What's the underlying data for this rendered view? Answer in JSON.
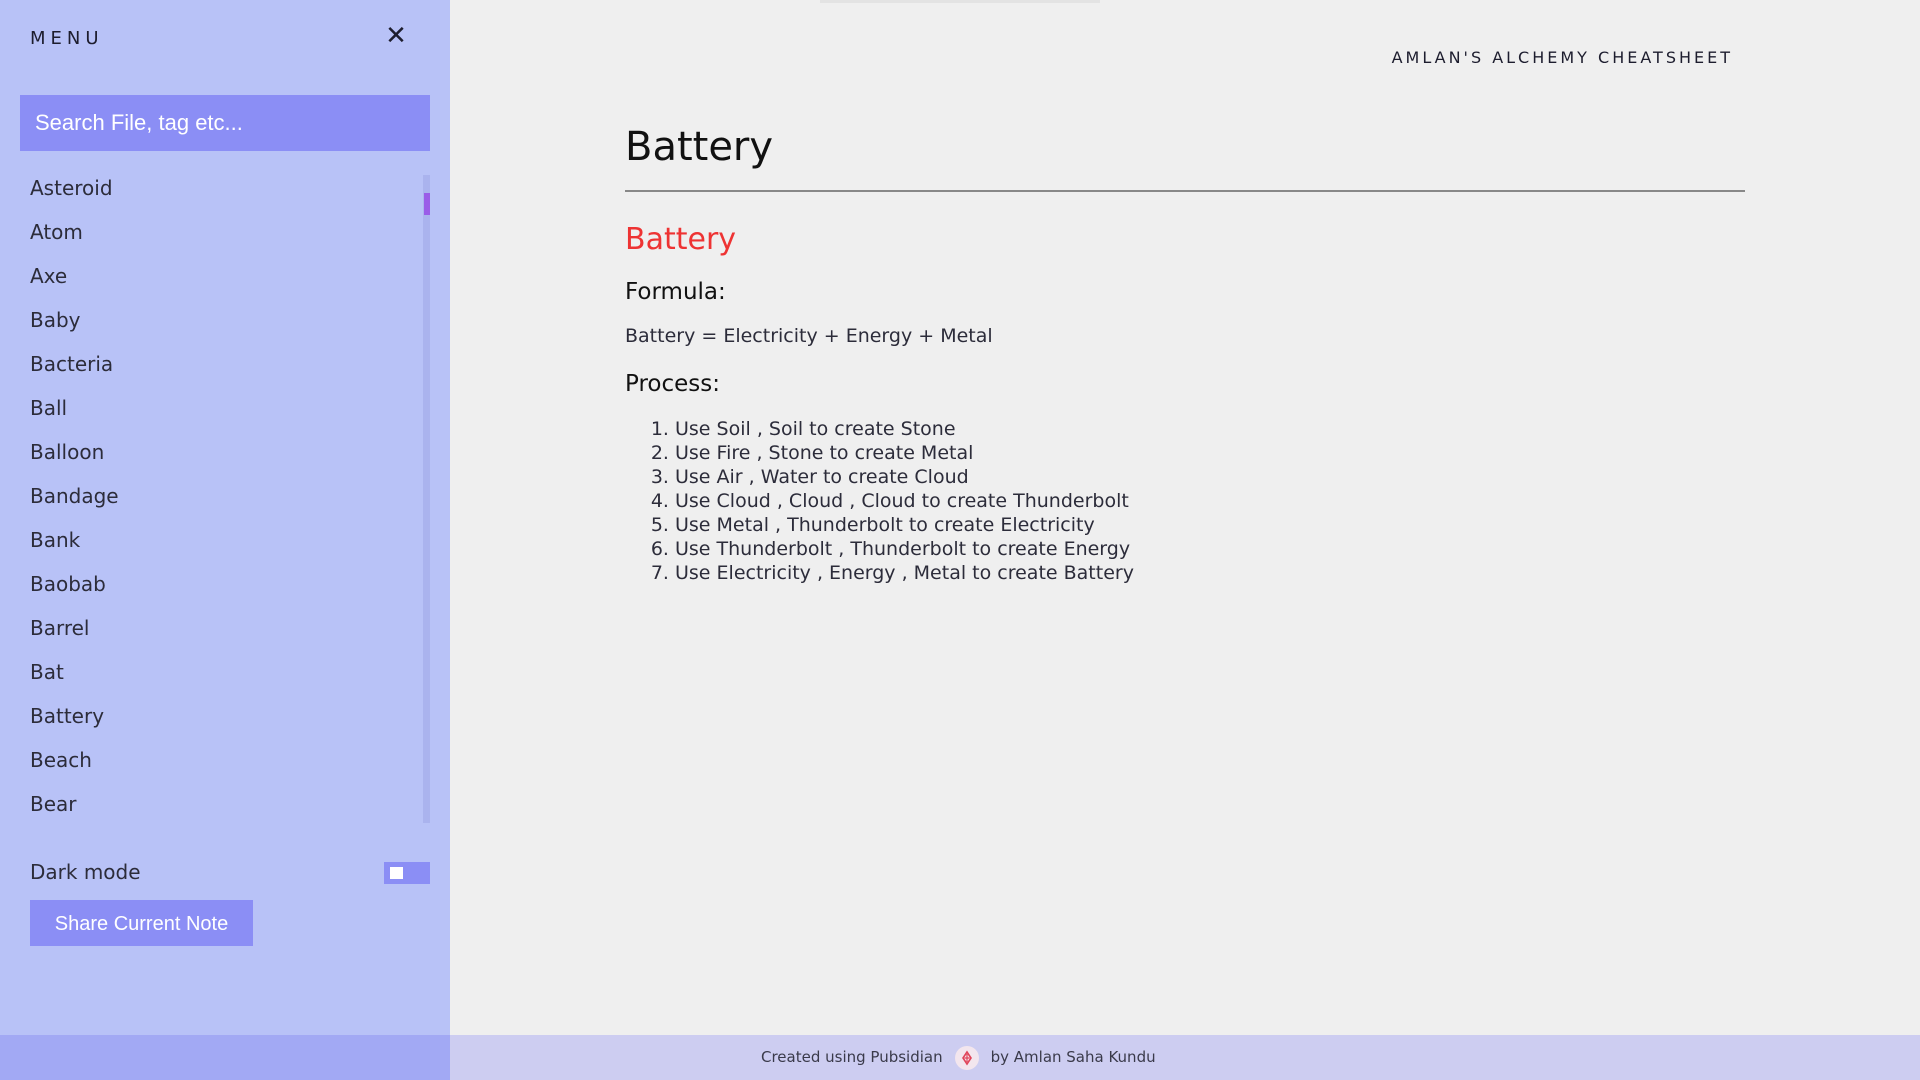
{
  "sidebar": {
    "menu_title": "MENU",
    "close_glyph": "✕",
    "search_placeholder": "Search File, tag etc...",
    "items": [
      {
        "label": "Asteroid"
      },
      {
        "label": "Atom"
      },
      {
        "label": "Axe"
      },
      {
        "label": "Baby"
      },
      {
        "label": "Bacteria"
      },
      {
        "label": "Ball"
      },
      {
        "label": "Balloon"
      },
      {
        "label": "Bandage"
      },
      {
        "label": "Bank"
      },
      {
        "label": "Baobab"
      },
      {
        "label": "Barrel"
      },
      {
        "label": "Bat"
      },
      {
        "label": "Battery"
      },
      {
        "label": "Beach"
      },
      {
        "label": "Bear"
      }
    ],
    "dark_mode_label": "Dark mode",
    "dark_mode_enabled": false,
    "share_label": "Share Current Note"
  },
  "header": {
    "site_title": "AMLAN'S ALCHEMY CHEATSHEET"
  },
  "note": {
    "page_title": "Battery",
    "heading": "Battery",
    "formula_heading": "Formula:",
    "formula": "Battery = Electricity + Energy + Metal",
    "process_heading": "Process:",
    "steps": [
      "Use Soil , Soil to create Stone",
      "Use Fire , Stone to create Metal",
      "Use Air , Water to create Cloud",
      "Use Cloud , Cloud , Cloud to create Thunderbolt",
      "Use Metal , Thunderbolt to create Electricity",
      "Use Thunderbolt , Thunderbolt to create Energy",
      "Use Electricity , Energy , Metal to create Battery"
    ]
  },
  "footer": {
    "created_text": "Created using Pubsidian",
    "author_text": "by Amlan Saha Kundu",
    "logo_icon": "pubsidian-logo-icon"
  },
  "colors": {
    "sidebar_bg": "#b8c2f7",
    "accent": "#8b8ef5",
    "heading_red": "#ee3333",
    "scroll_thumb": "#9a5de8"
  }
}
